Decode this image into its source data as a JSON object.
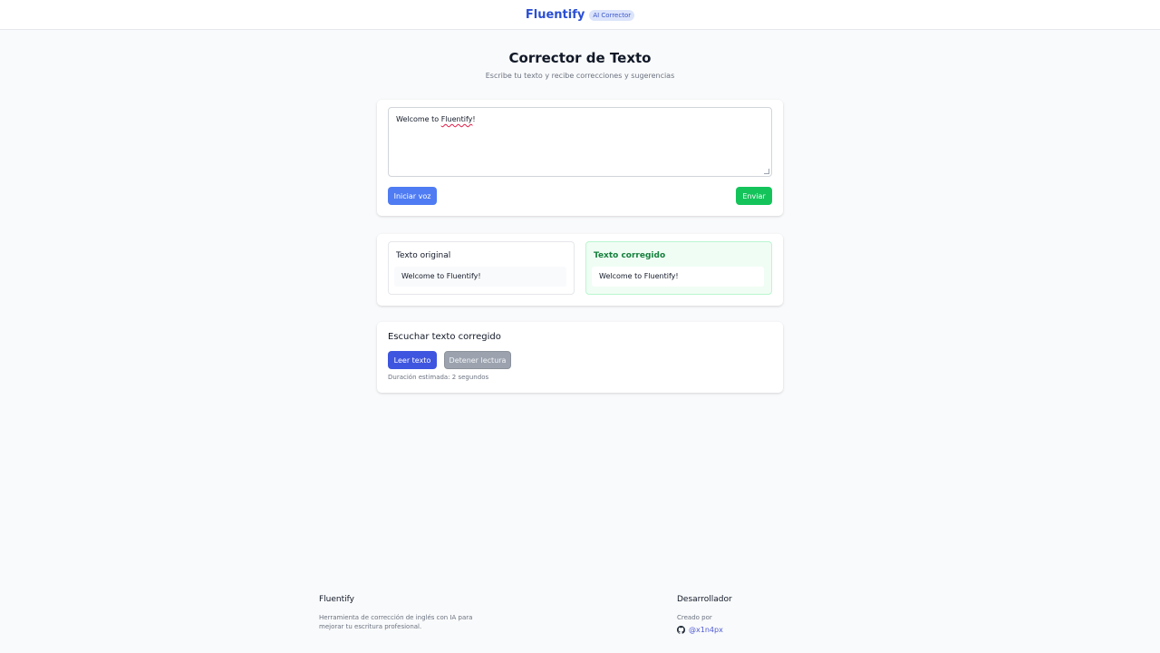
{
  "header": {
    "brand": "Fluentify",
    "badge": "AI Corrector"
  },
  "hero": {
    "title": "Corrector de Texto",
    "subtitle": "Escribe tu texto y recibe correcciones y sugerencias"
  },
  "editor": {
    "text_before": "Welcome to ",
    "text_misspelled": "Fluentify",
    "text_after": "!",
    "voice_button": "Iniciar voz",
    "send_button": "Enviar"
  },
  "comparison": {
    "original_heading": "Texto original",
    "original_text": "Welcome to Fluentify!",
    "corrected_heading": "Texto corregido",
    "corrected_text": "Welcome to Fluentify!"
  },
  "audio": {
    "heading": "Escuchar texto corregido",
    "read_button": "Leer texto",
    "stop_button": "Detener lectura",
    "duration": "Duración estimada: 2 segundos"
  },
  "footer": {
    "brand": "Fluentify",
    "description": "Herramienta de corrección de inglés con IA para mejorar tu escritura profesional.",
    "developer_heading": "Desarrollador",
    "created_by": "Creado por",
    "author_link": "@x1n4px",
    "author_icon": "github-icon"
  },
  "colors": {
    "brand": "#2b4fd4",
    "voice_button": "#4f7cf3",
    "send_button": "#14c45a",
    "read_button": "#3e55e0",
    "stop_button": "#9ca3af",
    "corrected_accent": "#15803d"
  }
}
